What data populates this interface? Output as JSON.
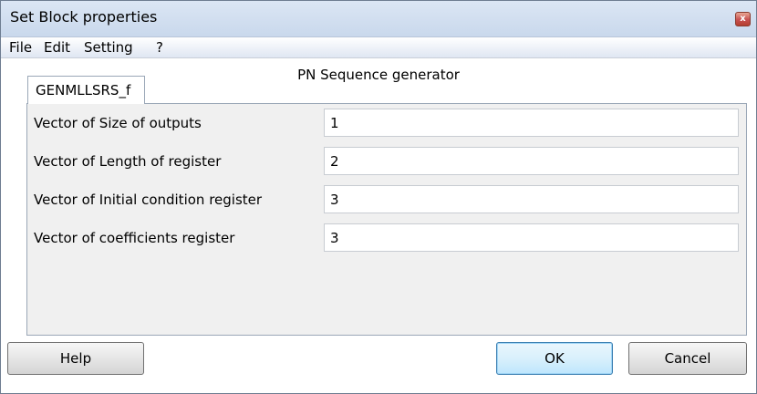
{
  "window": {
    "title": "Set Block properties",
    "close_glyph": "x"
  },
  "menu": {
    "items": [
      "File",
      "Edit",
      "Setting",
      "?"
    ]
  },
  "block": {
    "title": "PN Sequence generator"
  },
  "tab": {
    "label": "GENMLLSRS_f"
  },
  "parameters": [
    {
      "label": "Vector of Size of outputs",
      "value": "1"
    },
    {
      "label": "Vector of Length of register",
      "value": "2"
    },
    {
      "label": "Vector of Initial condition register",
      "value": "3"
    },
    {
      "label": "Vector of coefficients register",
      "value": "3"
    }
  ],
  "buttons": {
    "help": "Help",
    "ok": "OK",
    "cancel": "Cancel"
  }
}
